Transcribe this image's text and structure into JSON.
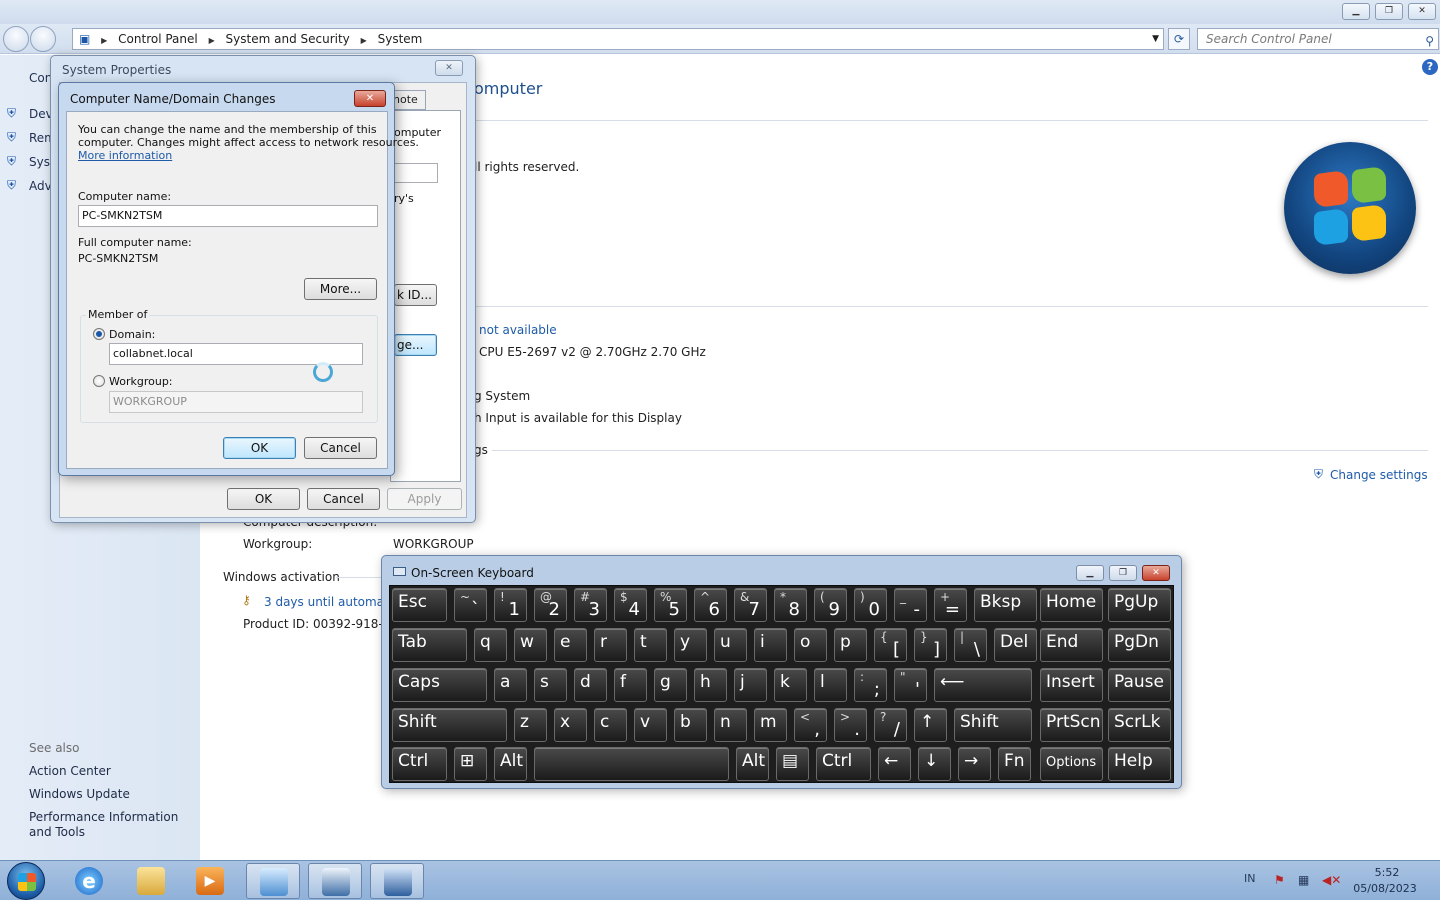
{
  "explorer": {
    "breadcrumb": [
      "Control Panel",
      "System and Security",
      "System"
    ],
    "search_placeholder": "Search Control Panel",
    "left_nav": [
      {
        "label": "Con"
      },
      {
        "label": "Dev"
      },
      {
        "label": "Rem"
      },
      {
        "label": "Syst"
      },
      {
        "label": "Adv"
      }
    ],
    "see_also_heading": "See also",
    "see_also": [
      "Action Center",
      "Windows Update",
      "Performance Information and Tools"
    ],
    "main": {
      "heading_fragment": "omputer",
      "copyright_fragment": "ll rights reserved.",
      "rating_fragment": "not available",
      "processor_fragment": "CPU E5-2697 v2 @ 2.70GHz   2.70 GHz",
      "system_type_fragment": "g System",
      "pen_touch_fragment": "h Input is available for this Display",
      "settings_fragment": "gs",
      "change_settings": "Change settings",
      "computer_description_label": "Computer description:",
      "workgroup_label": "Workgroup:",
      "workgroup_value": "WORKGROUP",
      "activation_heading": "Windows activation",
      "activation_link": "3 days until automati",
      "product_id": "Product ID: 00392-918-500"
    }
  },
  "system_properties": {
    "title": "System Properties",
    "tab_fragment": "note",
    "text_fragment_1": "omputer",
    "text_fragment_2": "ry's",
    "network_id_btn": "k ID...",
    "change_btn": "ge...",
    "ok": "OK",
    "cancel": "Cancel",
    "apply": "Apply"
  },
  "computer_name_dialog": {
    "title": "Computer Name/Domain Changes",
    "intro_line1": "You can change the name and the membership of this",
    "intro_line2": "computer. Changes might affect access to network resources.",
    "more_info": "More information",
    "computer_name_label": "Computer name:",
    "computer_name_value": "PC-SMKN2TSM",
    "full_name_label": "Full computer name:",
    "full_name_value": "PC-SMKN2TSM",
    "more_btn": "More...",
    "member_of": "Member of",
    "domain_label": "Domain:",
    "domain_value": "collabnet.local",
    "workgroup_label": "Workgroup:",
    "workgroup_value": "WORKGROUP",
    "ok": "OK",
    "cancel": "Cancel"
  },
  "osk": {
    "title": "On-Screen Keyboard",
    "rows": [
      [
        {
          "lbl": "Esc"
        },
        {
          "top": "~",
          "main": "`"
        },
        {
          "top": "!",
          "main": "1"
        },
        {
          "top": "@",
          "main": "2"
        },
        {
          "top": "#",
          "main": "3"
        },
        {
          "top": "$",
          "main": "4"
        },
        {
          "top": "%",
          "main": "5"
        },
        {
          "top": "^",
          "main": "6"
        },
        {
          "top": "&",
          "main": "7"
        },
        {
          "top": "*",
          "main": "8"
        },
        {
          "top": "(",
          "main": "9"
        },
        {
          "top": ")",
          "main": "0"
        },
        {
          "top": "_",
          "main": "-"
        },
        {
          "top": "+",
          "main": "="
        },
        {
          "lbl": "Bksp"
        },
        {
          "lbl": "Home"
        },
        {
          "lbl": "PgUp"
        }
      ],
      [
        {
          "lbl": "Tab"
        },
        {
          "lbl": "q"
        },
        {
          "lbl": "w"
        },
        {
          "lbl": "e"
        },
        {
          "lbl": "r"
        },
        {
          "lbl": "t"
        },
        {
          "lbl": "y"
        },
        {
          "lbl": "u"
        },
        {
          "lbl": "i"
        },
        {
          "lbl": "o"
        },
        {
          "lbl": "p"
        },
        {
          "top": "{",
          "main": "["
        },
        {
          "top": "}",
          "main": "]"
        },
        {
          "top": "|",
          "main": "\\"
        },
        {
          "lbl": "Del"
        },
        {
          "lbl": "End"
        },
        {
          "lbl": "PgDn"
        }
      ],
      [
        {
          "lbl": "Caps"
        },
        {
          "lbl": "a"
        },
        {
          "lbl": "s"
        },
        {
          "lbl": "d"
        },
        {
          "lbl": "f"
        },
        {
          "lbl": "g"
        },
        {
          "lbl": "h"
        },
        {
          "lbl": "j"
        },
        {
          "lbl": "k"
        },
        {
          "lbl": "l"
        },
        {
          "top": ":",
          "main": ";"
        },
        {
          "top": "\"",
          "main": "'"
        },
        {
          "lbl": "⟵"
        },
        {
          "lbl": "Insert"
        },
        {
          "lbl": "Pause"
        }
      ],
      [
        {
          "lbl": "Shift"
        },
        {
          "lbl": "z"
        },
        {
          "lbl": "x"
        },
        {
          "lbl": "c"
        },
        {
          "lbl": "v"
        },
        {
          "lbl": "b"
        },
        {
          "lbl": "n"
        },
        {
          "lbl": "m"
        },
        {
          "top": "<",
          "main": ","
        },
        {
          "top": ">",
          "main": "."
        },
        {
          "top": "?",
          "main": "/"
        },
        {
          "lbl": "↑"
        },
        {
          "lbl": "Shift"
        },
        {
          "lbl": "PrtScn"
        },
        {
          "lbl": "ScrLk"
        }
      ],
      [
        {
          "lbl": "Ctrl"
        },
        {
          "lbl": "⊞"
        },
        {
          "lbl": "Alt"
        },
        {
          "lbl": ""
        },
        {
          "lbl": "Alt"
        },
        {
          "lbl": "▤"
        },
        {
          "lbl": "Ctrl"
        },
        {
          "lbl": "←"
        },
        {
          "lbl": "↓"
        },
        {
          "lbl": "→"
        },
        {
          "lbl": "Fn"
        },
        {
          "lbl": "Options"
        },
        {
          "lbl": "Help"
        }
      ]
    ]
  },
  "taskbar": {
    "language": "IN",
    "time": "5:52",
    "date": "05/08/2023"
  },
  "colors": {
    "link": "#1e5ba8",
    "key_bg": "#2a2a2a",
    "taskbar": "#9fbbe0"
  }
}
